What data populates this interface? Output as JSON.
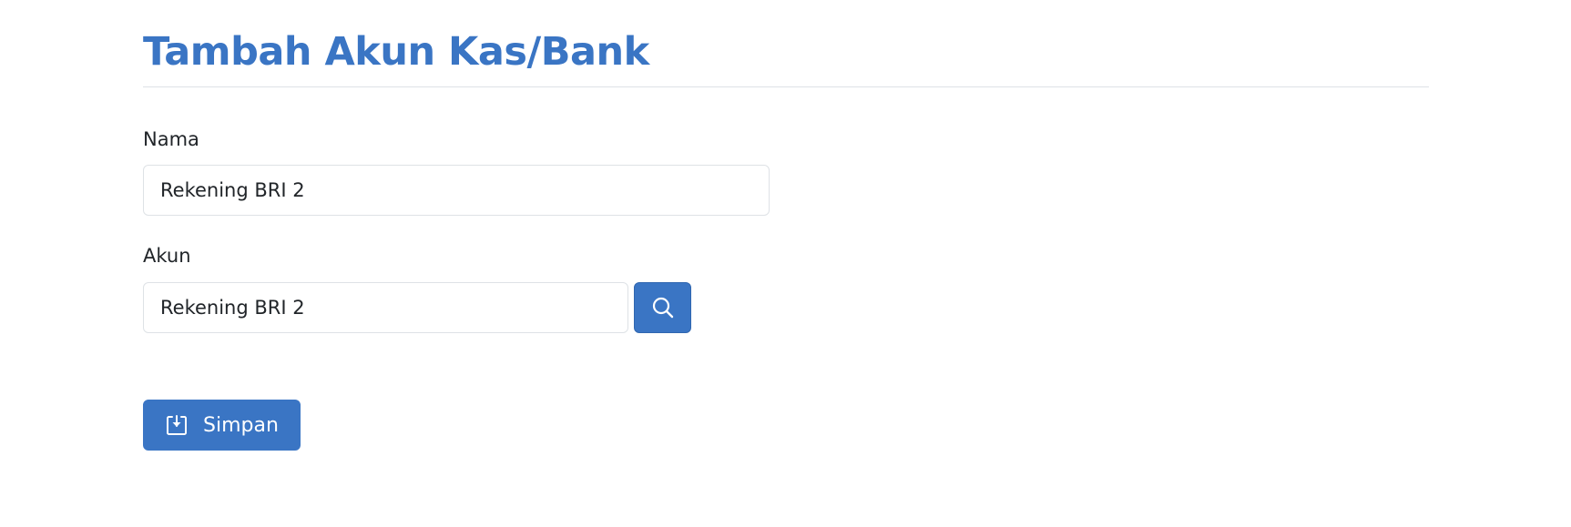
{
  "page": {
    "title": "Tambah Akun Kas/Bank"
  },
  "form": {
    "nama": {
      "label": "Nama",
      "value": "Rekening BRI 2"
    },
    "akun": {
      "label": "Akun",
      "value": "Rekening BRI 2",
      "search_icon": "search-icon"
    },
    "save_button": {
      "label": "Simpan",
      "icon": "save-icon"
    }
  },
  "colors": {
    "accent": "#3a75c4",
    "text": "#212529",
    "border": "#dee2e6"
  }
}
